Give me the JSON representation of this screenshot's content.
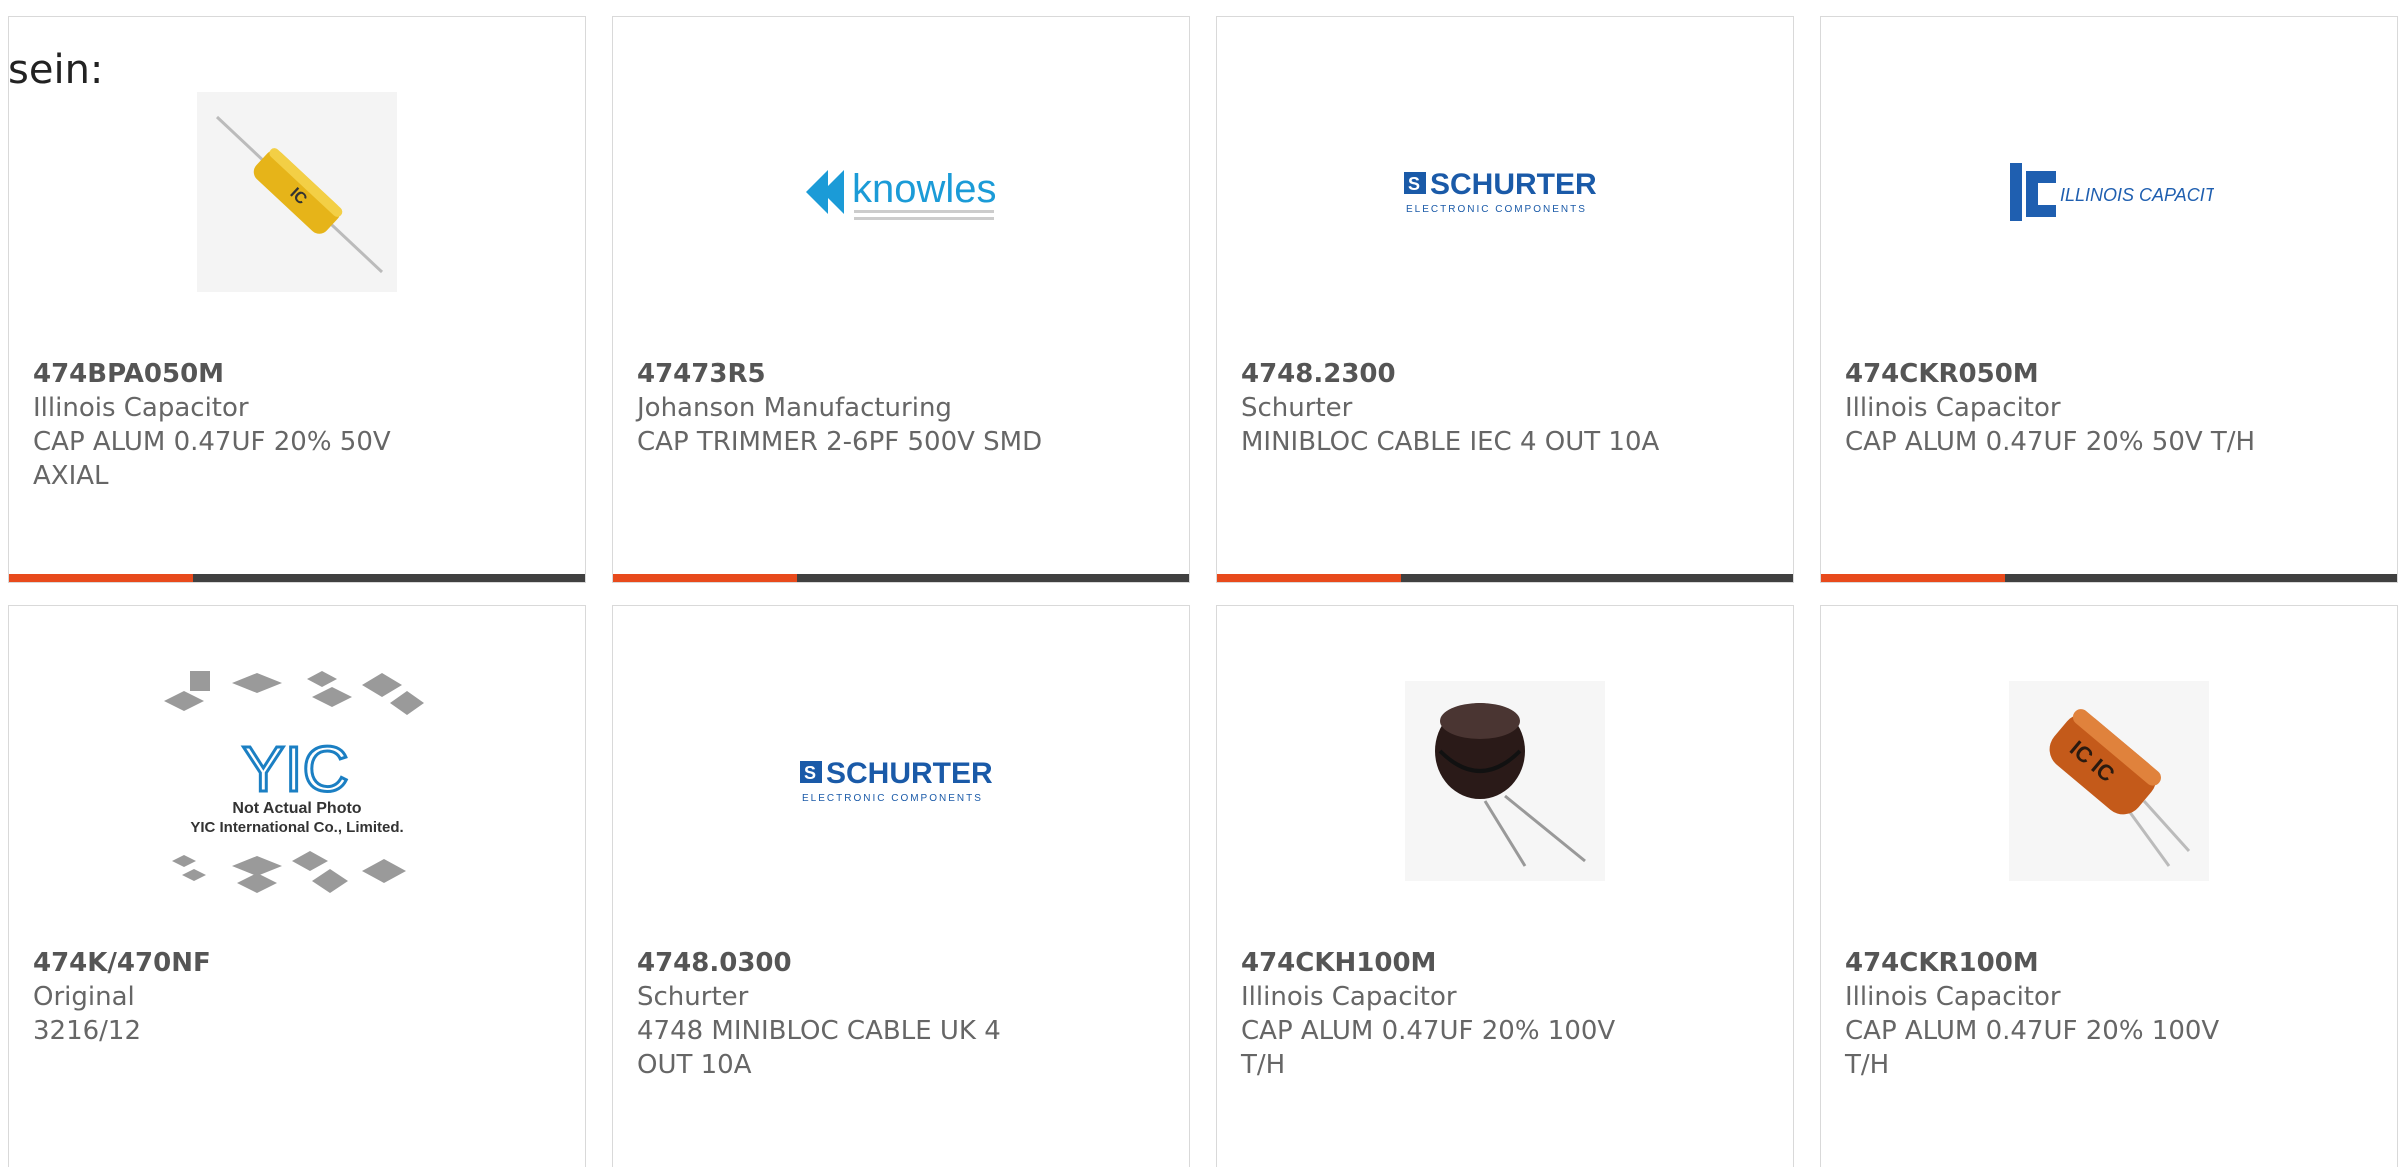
{
  "intro_text": "sein:",
  "accent_color": "#e84a1c",
  "bar_color": "#404040",
  "cards": [
    {
      "part": "474BPA050M",
      "maker": "Illinois Capacitor",
      "desc": "CAP ALUM 0.47UF 20% 50V AXIAL",
      "image": "yellow-axial-capacitor",
      "progress": 0.32
    },
    {
      "part": "47473R5",
      "maker": "Johanson Manufacturing",
      "desc": "CAP TRIMMER 2-6PF 500V SMD",
      "image": "knowles-logo",
      "logo_text": "knowles",
      "progress": 0.32
    },
    {
      "part": "4748.2300",
      "maker": "Schurter",
      "desc": "MINIBLOC CABLE IEC 4 OUT 10A",
      "image": "schurter-logo",
      "logo_text": "SCHURTER",
      "logo_sub": "ELECTRONIC COMPONENTS",
      "progress": 0.32
    },
    {
      "part": "474CKR050M",
      "maker": "Illinois Capacitor",
      "desc": "CAP ALUM 0.47UF 20% 50V T/H",
      "image": "illinois-capacitor-logo",
      "logo_text": "ILLINOIS CAPACITOR, INC.",
      "progress": 0.32
    },
    {
      "part": "474K/470NF",
      "maker": "Original",
      "desc": "3216/12",
      "image": "yic-placeholder",
      "logo_text": "YIC",
      "logo_sub": "Not Actual Photo",
      "logo_sub2": "YIC International Co., Limited."
    },
    {
      "part": "4748.0300",
      "maker": "Schurter",
      "desc": "4748 MINIBLOC CABLE UK 4 OUT 10A",
      "image": "schurter-logo",
      "logo_text": "SCHURTER",
      "logo_sub": "ELECTRONIC COMPONENTS"
    },
    {
      "part": "474CKH100M",
      "maker": "Illinois Capacitor",
      "desc": "CAP ALUM 0.47UF 20% 100V T/H",
      "image": "black-radial-capacitor"
    },
    {
      "part": "474CKR100M",
      "maker": "Illinois Capacitor",
      "desc": "CAP ALUM 0.47UF 20% 100V T/H",
      "image": "orange-radial-capacitor"
    }
  ]
}
